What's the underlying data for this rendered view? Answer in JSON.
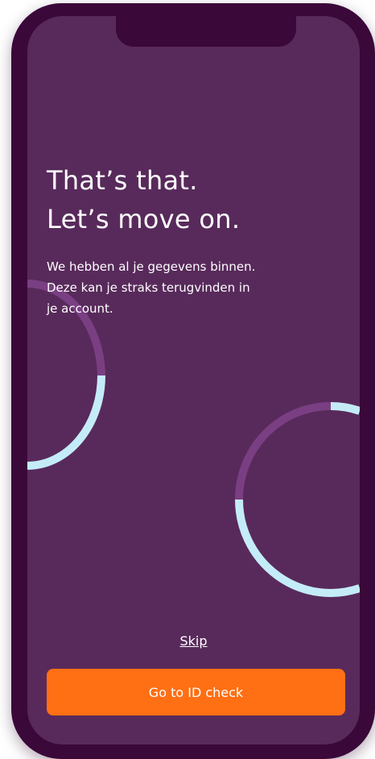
{
  "content": {
    "headline_line1": "That’s that.",
    "headline_line2": "Let’s move on.",
    "body_line1": "We hebben al je gegevens binnen.",
    "body_line2": "Deze kan je straks terugvinden in",
    "body_line3": "je account."
  },
  "actions": {
    "skip_label": "Skip",
    "primary_label": "Go to ID check"
  },
  "colors": {
    "device_frame": "#3a0839",
    "screen_background": "#582a5b",
    "ring_purple": "#7a3f82",
    "ring_light_blue": "#c4ecf8",
    "button_orange": "#ff6f14",
    "text": "#ffffff"
  }
}
